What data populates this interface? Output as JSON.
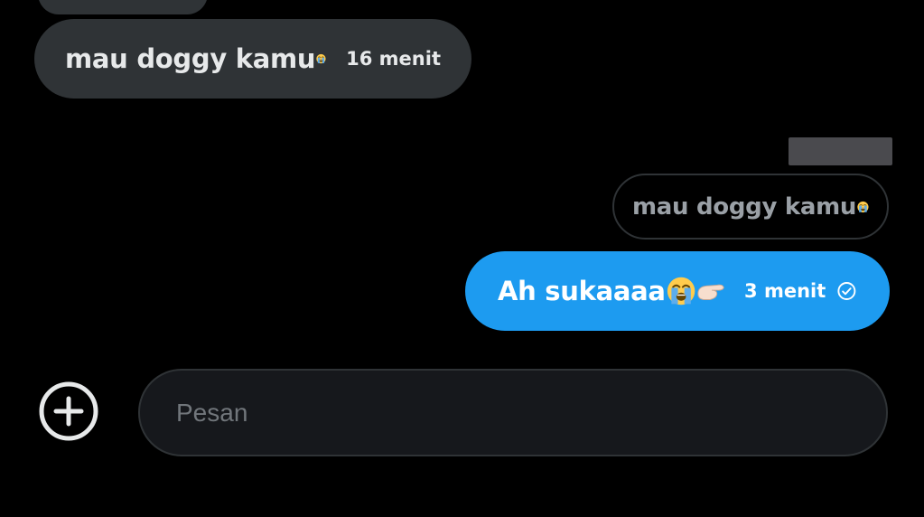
{
  "colors": {
    "background": "#000000",
    "received_bubble": "#2f3336",
    "sent_bubble": "#1d9bf0",
    "text_primary": "#e7e9ea",
    "text_muted": "#9aa0a6",
    "composer_bg": "#16181c"
  },
  "messages": {
    "received": {
      "text": "mau doggy kamu",
      "emoji": "loudly-crying-face",
      "time": "16 menit"
    },
    "reply_quote": {
      "text": "mau doggy kamu",
      "emoji": "loudly-crying-face"
    },
    "sent": {
      "text": "Ah sukaaaa",
      "emojis": [
        "loudly-crying-face",
        "pinching-hand"
      ],
      "time": "3 menit",
      "status_icon": "check-circle-icon"
    }
  },
  "composer": {
    "placeholder": "Pesan",
    "value": "",
    "add_icon": "plus-circle-icon"
  }
}
